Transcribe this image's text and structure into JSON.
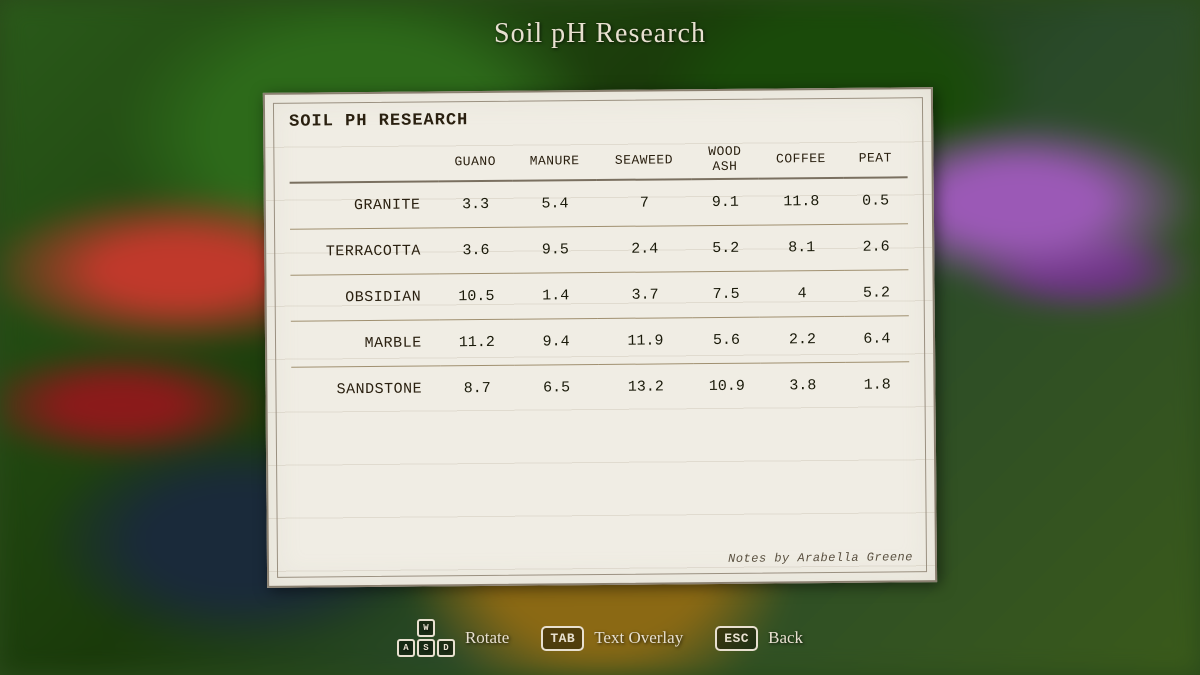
{
  "page": {
    "title": "Soil pH Research",
    "background_colors": [
      "#2a5a1a",
      "#1a3a0a"
    ]
  },
  "table": {
    "title": "Soil pH Research",
    "columns": [
      {
        "id": "row",
        "label": "",
        "label2": ""
      },
      {
        "id": "guano",
        "label": "Guano",
        "label2": ""
      },
      {
        "id": "manure",
        "label": "Manure",
        "label2": ""
      },
      {
        "id": "seaweed",
        "label": "Seaweed",
        "label2": ""
      },
      {
        "id": "wood_ash",
        "label": "Wood",
        "label2": "Ash"
      },
      {
        "id": "coffee",
        "label": "Coffee",
        "label2": ""
      },
      {
        "id": "peat",
        "label": "Peat",
        "label2": ""
      }
    ],
    "rows": [
      {
        "name": "Granite",
        "guano": "3.3",
        "manure": "5.4",
        "seaweed": "7",
        "wood_ash": "9.1",
        "coffee": "11.8",
        "peat": "0.5"
      },
      {
        "name": "Terracotta",
        "guano": "3.6",
        "manure": "9.5",
        "seaweed": "2.4",
        "wood_ash": "5.2",
        "coffee": "8.1",
        "peat": "2.6"
      },
      {
        "name": "Obsidian",
        "guano": "10.5",
        "manure": "1.4",
        "seaweed": "3.7",
        "wood_ash": "7.5",
        "coffee": "4",
        "peat": "5.2"
      },
      {
        "name": "Marble",
        "guano": "11.2",
        "manure": "9.4",
        "seaweed": "11.9",
        "wood_ash": "5.6",
        "coffee": "2.2",
        "peat": "6.4"
      },
      {
        "name": "Sandstone",
        "guano": "8.7",
        "manure": "6.5",
        "seaweed": "13.2",
        "wood_ash": "10.9",
        "coffee": "3.8",
        "peat": "1.8"
      }
    ],
    "attribution": "Notes by Arabella Greene"
  },
  "controls": [
    {
      "id": "rotate",
      "key_type": "wasd",
      "key_label": "WASD",
      "action_label": "Rotate"
    },
    {
      "id": "text_overlay",
      "key_type": "text",
      "key_label": "TAB",
      "action_label": "Text Overlay"
    },
    {
      "id": "back",
      "key_type": "text",
      "key_label": "ESC",
      "action_label": "Back"
    }
  ]
}
